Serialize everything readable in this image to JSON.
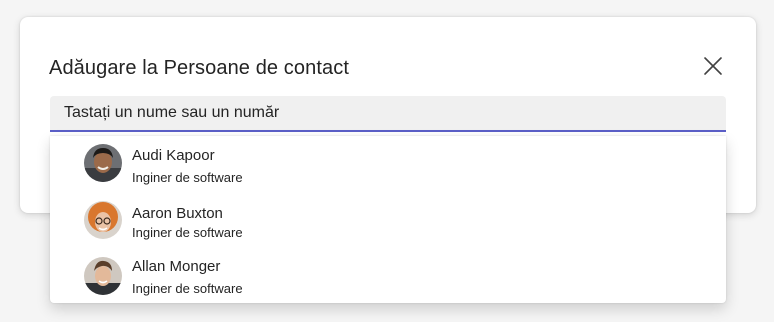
{
  "dialog": {
    "title": "Adăugare la Persoane de contact",
    "close_icon": "close-icon"
  },
  "search": {
    "placeholder": "Tastați un nume sau un număr",
    "value": "",
    "accent_color": "#5b5fc7"
  },
  "suggestions": [
    {
      "name": "Audi Kapoor",
      "role": "Inginer de software",
      "avatar_icon": "avatar-photo"
    },
    {
      "name": "Aaron Buxton",
      "role": "Inginer de software",
      "avatar_icon": "avatar-photo"
    },
    {
      "name": "Allan Monger",
      "role": "Inginer de software",
      "avatar_icon": "avatar-photo"
    }
  ]
}
